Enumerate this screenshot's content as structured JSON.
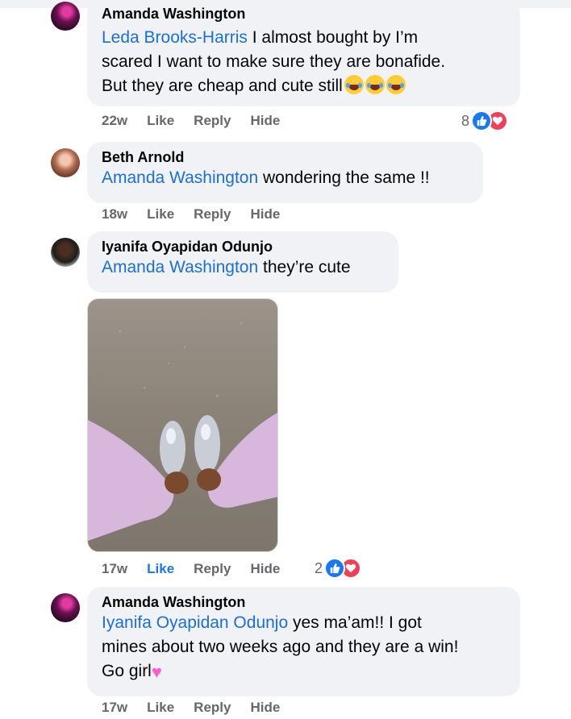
{
  "comments": [
    {
      "author": "Amanda Washington",
      "mention": "Leda Brooks-Harris",
      "lines": [
        " I almost bought by I’m",
        "scared I want to make sure they are bonafide.",
        "But they are cheap and cute still"
      ],
      "emoji": [
        "grinning-squinting-tears-emoji",
        "grinning-squinting-tears-emoji",
        "grinning-squinting-tears-emoji"
      ],
      "time": "22w",
      "actions": [
        "Like",
        "Reply",
        "Hide"
      ],
      "reaction_count": "8"
    },
    {
      "author": "Beth Arnold",
      "mention": "Amanda Washington",
      "text": " wondering the same !!",
      "time": "18w",
      "actions": [
        "Like",
        "Reply",
        "Hide"
      ]
    },
    {
      "author": "Iyanifa Oyapidan Odunjo",
      "mention": "Amanda Washington",
      "text": " they’re cute",
      "time": "17w",
      "actions": [
        "Like",
        "Reply",
        "Hide"
      ],
      "like_active": true,
      "reaction_count": "2",
      "has_photo": true
    },
    {
      "author": "Amanda Washington",
      "mention": "Iyanifa Oyapidan Odunjo",
      "lines": [
        " yes ma’am!! I got",
        "mines about two weeks ago and they are a win!",
        "Go girl"
      ],
      "emoji": [
        "pink-heart-emoji"
      ],
      "time": "17w",
      "actions": [
        "Like",
        "Reply",
        "Hide"
      ]
    }
  ],
  "colors": {
    "bubble": "#f0f2f5",
    "mention": "#1b6fd8",
    "meta": "#65676b",
    "like_active": "#1877f2",
    "like_reaction": "#1877f2",
    "love_reaction": "#f33e58"
  }
}
